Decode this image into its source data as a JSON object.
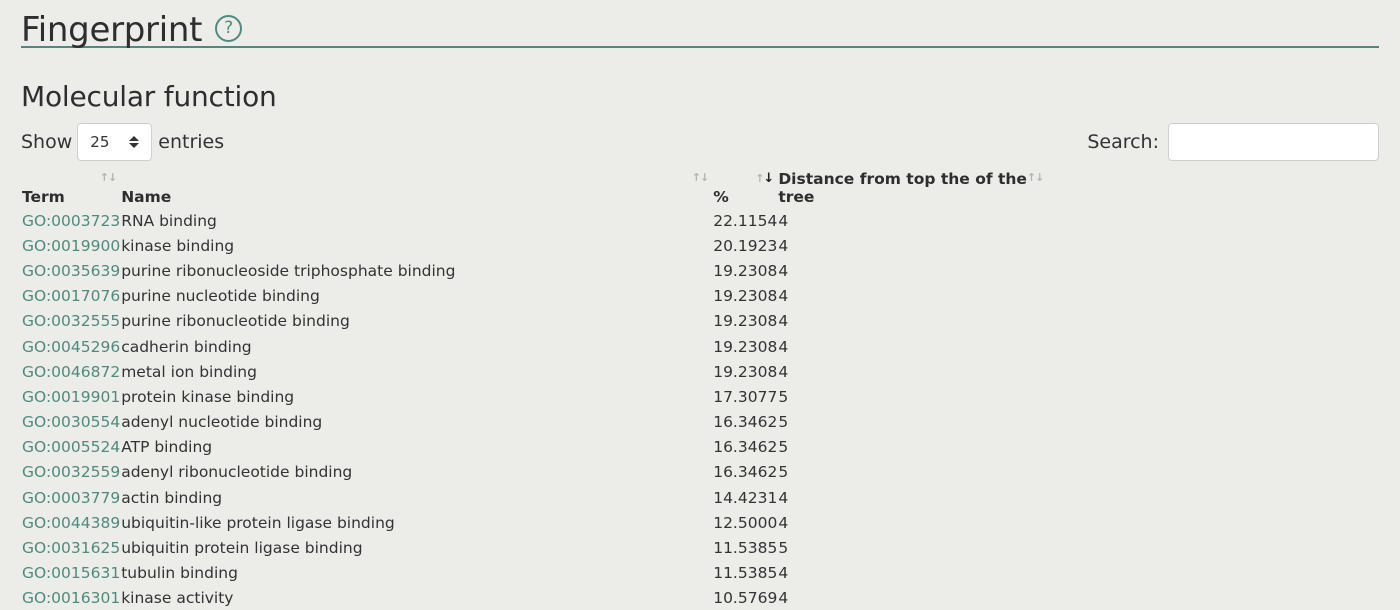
{
  "header": {
    "title": "Fingerprint",
    "help_icon": "question-circle-icon"
  },
  "section": {
    "title": "Molecular function"
  },
  "length_control": {
    "prefix": "Show",
    "selected": "25",
    "suffix": "entries"
  },
  "search": {
    "label": "Search:",
    "value": "",
    "placeholder": ""
  },
  "colors": {
    "accent": "#4f8a7e",
    "background": "#ecece9"
  },
  "table": {
    "columns": [
      "Term",
      "Name",
      "%",
      "Distance from top the of the tree"
    ],
    "sorted_column": "%",
    "sort_direction": "descending",
    "rows": [
      {
        "term": "GO:0003723",
        "name": "RNA binding",
        "pct": "22.1154",
        "dist": "4"
      },
      {
        "term": "GO:0019900",
        "name": "kinase binding",
        "pct": "20.1923",
        "dist": "4"
      },
      {
        "term": "GO:0035639",
        "name": "purine ribonucleoside triphosphate binding",
        "pct": "19.2308",
        "dist": "4"
      },
      {
        "term": "GO:0017076",
        "name": "purine nucleotide binding",
        "pct": "19.2308",
        "dist": "4"
      },
      {
        "term": "GO:0032555",
        "name": "purine ribonucleotide binding",
        "pct": "19.2308",
        "dist": "4"
      },
      {
        "term": "GO:0045296",
        "name": "cadherin binding",
        "pct": "19.2308",
        "dist": "4"
      },
      {
        "term": "GO:0046872",
        "name": "metal ion binding",
        "pct": "19.2308",
        "dist": "4"
      },
      {
        "term": "GO:0019901",
        "name": "protein kinase binding",
        "pct": "17.3077",
        "dist": "5"
      },
      {
        "term": "GO:0030554",
        "name": "adenyl nucleotide binding",
        "pct": "16.3462",
        "dist": "5"
      },
      {
        "term": "GO:0005524",
        "name": "ATP binding",
        "pct": "16.3462",
        "dist": "5"
      },
      {
        "term": "GO:0032559",
        "name": "adenyl ribonucleotide binding",
        "pct": "16.3462",
        "dist": "5"
      },
      {
        "term": "GO:0003779",
        "name": "actin binding",
        "pct": "14.4231",
        "dist": "4"
      },
      {
        "term": "GO:0044389",
        "name": "ubiquitin-like protein ligase binding",
        "pct": "12.5000",
        "dist": "4"
      },
      {
        "term": "GO:0031625",
        "name": "ubiquitin protein ligase binding",
        "pct": "11.5385",
        "dist": "5"
      },
      {
        "term": "GO:0015631",
        "name": "tubulin binding",
        "pct": "11.5385",
        "dist": "4"
      },
      {
        "term": "GO:0016301",
        "name": "kinase activity",
        "pct": "10.5769",
        "dist": "4"
      }
    ]
  }
}
